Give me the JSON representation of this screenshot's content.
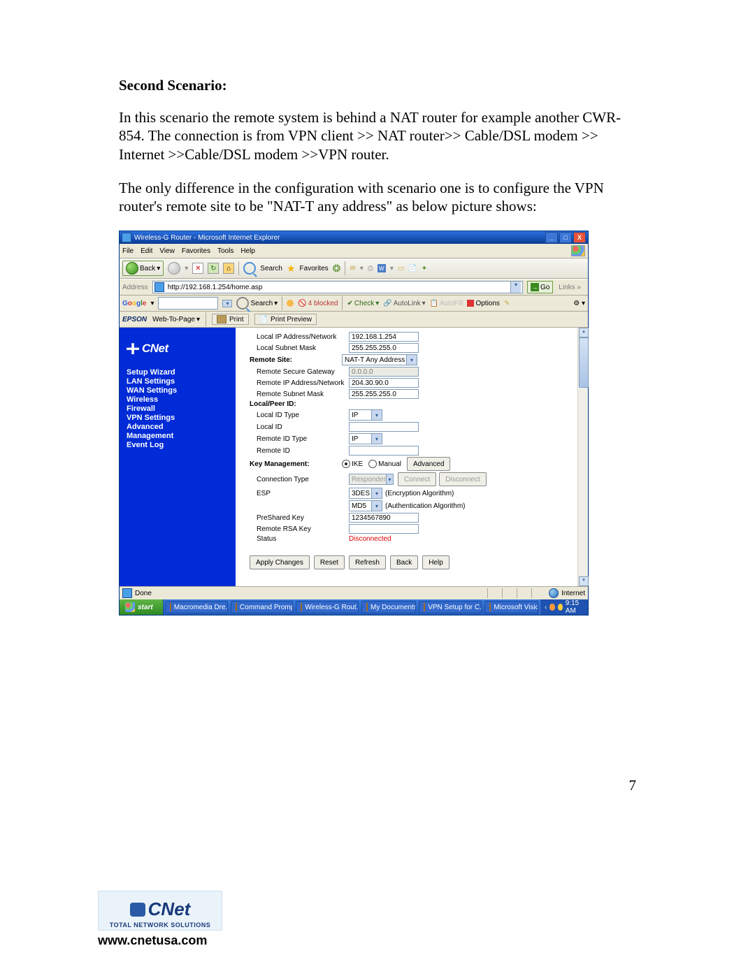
{
  "doc": {
    "heading": "Second Scenario:",
    "para1": "In this scenario the remote system is behind a NAT router for example another CWR-854.  The connection is from VPN client >> NAT router>> Cable/DSL modem >> Internet >>Cable/DSL modem >>VPN router.",
    "para2": "The only difference in the configuration with scenario one is to configure the VPN router's remote site to be \"NAT-T any address\" as below picture shows:",
    "page_number": "7",
    "footer_tag": "TOTAL NETWORK SOLUTIONS",
    "footer_brand": "CNet",
    "footer_url": "www.cnetusa.com"
  },
  "browser": {
    "title": "Wireless-G Router - Microsoft Internet Explorer",
    "menus": [
      "File",
      "Edit",
      "View",
      "Favorites",
      "Tools",
      "Help"
    ],
    "toolbar": {
      "back": "Back",
      "search": "Search",
      "favorites": "Favorites"
    },
    "address_label": "Address",
    "address_value": "http://192.168.1.254/home.asp",
    "go": "Go",
    "links": "Links",
    "status_done": "Done",
    "status_zone": "Internet"
  },
  "google_bar": {
    "logo_g": "G",
    "logo_o1": "o",
    "logo_o2": "o",
    "logo_g2": "g",
    "logo_l": "l",
    "logo_e": "e",
    "search": "Search",
    "blocked": "4 blocked",
    "check": "Check",
    "autolink": "AutoLink",
    "autofill": "AutoFill",
    "options": "Options"
  },
  "epson_bar": {
    "brand": "EPSON",
    "webtopage": "Web-To-Page",
    "print": "Print",
    "preview": "Print Preview"
  },
  "sidebar": {
    "brand": "CNet",
    "items": [
      "Setup Wizard",
      "LAN Settings",
      "WAN Settings",
      "Wireless",
      "Firewall",
      "VPN Settings",
      "Advanced",
      "Management",
      "Event Log"
    ]
  },
  "form": {
    "local_ip_label": "Local IP Address/Network",
    "local_ip": "192.168.1.254",
    "local_mask_label": "Local Subnet Mask",
    "local_mask": "255.255.255.0",
    "remote_site_label": "Remote Site:",
    "remote_site_value": "NAT-T Any Address",
    "remote_gw_label": "Remote Secure Gateway",
    "remote_gw": "0.0.0.0",
    "remote_ip_label": "Remote IP Address/Network",
    "remote_ip": "204.30.90.0",
    "remote_mask_label": "Remote Subnet Mask",
    "remote_mask": "255.255.255.0",
    "localpeer_label": "Local/Peer ID:",
    "local_id_type_label": "Local ID Type",
    "local_id_type": "IP",
    "local_id_label": "Local ID",
    "local_id": "",
    "remote_id_type_label": "Remote ID Type",
    "remote_id_type": "IP",
    "remote_id_label": "Remote ID",
    "remote_id": "",
    "keymgmt_label": "Key Management:",
    "radio_ike": "IKE",
    "radio_manual": "Manual",
    "advanced_btn": "Advanced",
    "conn_type_label": "Connection Type",
    "conn_type_value": "Responder",
    "connect_btn": "Connect",
    "disconnect_btn": "Disconnect",
    "esp_label": "ESP",
    "esp_enc": "3DES",
    "esp_enc_hint": "(Encryption Algorithm)",
    "esp_auth": "MD5",
    "esp_auth_hint": "(Authentication Algorithm)",
    "psk_label": "PreShared Key",
    "psk": "1234567890",
    "rsa_label": "Remote RSA Key",
    "rsa": "",
    "status_label": "Status",
    "status_value": "Disconnected",
    "buttons": [
      "Apply Changes",
      "Reset",
      "Refresh",
      "Back",
      "Help"
    ]
  },
  "taskbar": {
    "start": "start",
    "tasks": [
      "Macromedia Dre...",
      "Command Prompt",
      "Wireless-G Rout...",
      "My Documents",
      "VPN Setup for C...",
      "Microsoft Visio"
    ],
    "clock": "9:15 AM"
  }
}
